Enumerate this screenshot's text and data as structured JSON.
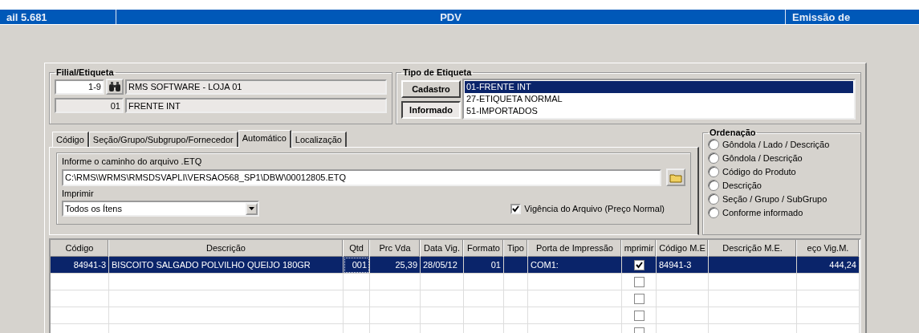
{
  "title_bar": {
    "left": "ail 5.681",
    "center": "PDV",
    "right": "Emissão de"
  },
  "filial": {
    "legend": "Filial/Etiqueta",
    "code": "1-9",
    "name": "RMS SOFTWARE - LOJA 01",
    "label_code": "01",
    "label_name": "FRENTE INT"
  },
  "tipo": {
    "legend": "Tipo de Etiqueta",
    "buttons": [
      {
        "label": "Cadastro",
        "pressed": false
      },
      {
        "label": "Informado",
        "pressed": true
      }
    ],
    "items": [
      {
        "label": "01-FRENTE INT",
        "selected": true
      },
      {
        "label": "27-ETIQUETA NORMAL",
        "selected": false
      },
      {
        "label": "51-IMPORTADOS",
        "selected": false
      }
    ]
  },
  "tabs": [
    {
      "label": "Código",
      "selected": false
    },
    {
      "label": "Seção/Grupo/Subgrupo/Fornecedor",
      "selected": false
    },
    {
      "label": "Automático",
      "selected": true
    },
    {
      "label": "Localização",
      "selected": false
    }
  ],
  "automatico": {
    "path_label": "Informe o caminho do arquivo .ETQ",
    "path": "C:\\RMS\\WRMS\\RMSDSVAPLI\\VERSAO568_SP1\\DBW\\00012805.ETQ",
    "print_label": "Imprimir",
    "print_value": "Todos os Ítens",
    "vigencia": {
      "label": "Vigência do Arquivo (Preço Normal)",
      "checked": true
    }
  },
  "ordenacao": {
    "legend": "Ordenação",
    "options": [
      {
        "label": "Gôndola / Lado / Descrição",
        "selected": false
      },
      {
        "label": "Gôndola / Descrição",
        "selected": false
      },
      {
        "label": "Código do Produto",
        "selected": false
      },
      {
        "label": "Descrição",
        "selected": false
      },
      {
        "label": "Seção / Grupo / SubGrupo",
        "selected": false
      },
      {
        "label": "Conforme informado",
        "selected": false
      }
    ]
  },
  "table": {
    "columns": [
      "Código",
      "Descrição",
      "Qtd",
      "Prc Vda",
      "Data Vig.",
      "Formato",
      "Tipo",
      "Porta de Impressão",
      "mprimir",
      "Código M.E",
      "Descrição M.E.",
      "eço Vig.M."
    ],
    "rows": [
      {
        "selected": true,
        "imprimir": true,
        "cells": {
          "codigo": "84941-3",
          "descricao": "BISCOITO SALGADO POLVILHO QUEIJO 180GR",
          "qtd": "001",
          "prc_vda": "25,39",
          "data_vig": "28/05/12",
          "formato": "01",
          "porta": "COM1:",
          "codigo_me": "84941-3",
          "preco_vig_m": "444,24"
        }
      },
      {
        "selected": false,
        "imprimir": false,
        "cells": {}
      },
      {
        "selected": false,
        "imprimir": false,
        "cells": {}
      },
      {
        "selected": false,
        "imprimir": false,
        "cells": {}
      },
      {
        "selected": false,
        "imprimir": false,
        "cells": {}
      }
    ]
  }
}
